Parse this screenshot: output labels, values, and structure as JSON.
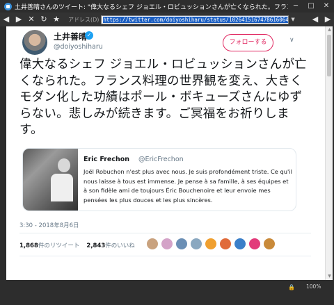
{
  "window": {
    "title": "土井善晴さんのツイート: \"偉大なるシェフ ジョエル・ロビュッションさんが亡くなられた。フランス"
  },
  "nav": {
    "address_label": "アドレス(D)",
    "url": "https://twitter.com/doiyoshiharu/status/1026415167478616064"
  },
  "tweet": {
    "display_name": "土井善晴",
    "handle": "@doiyoshiharu",
    "follow_label": "フォローする",
    "text": "偉大なるシェフ ジョエル・ロビュッションさんが亡くなられた。フランス料理の世界観を変え、大きくモダン化した功績はポール・ボキューズさんにゆずらない。悲しみが続きます。ご冥福をお祈りします。",
    "timestamp": "3:30 - 2018年8月6日",
    "retweets_count": "1,868",
    "retweets_label": "件のリツイート",
    "likes_count": "2,843",
    "likes_label": "件のいいね"
  },
  "quote": {
    "name": "Eric Frechon",
    "handle": "@EricFrechon",
    "text": "Joël Robuchon n'est plus avec nous. Je suis profondément triste. Ce qu'il nous laisse à tous est immense. Je pense à sa famille, à ses équipes et à son fidèle ami de toujours Éric Bouchenoire et leur envoie mes pensées les plus douces et les plus sincères."
  },
  "liker_colors": [
    "#c9a27e",
    "#d4a3c8",
    "#6b8fb5",
    "#8aa8c0",
    "#f0a030",
    "#e06b3a",
    "#3a7fc9",
    "#e23a7a",
    "#c98a3a"
  ],
  "status": {
    "zoom": "100%"
  }
}
